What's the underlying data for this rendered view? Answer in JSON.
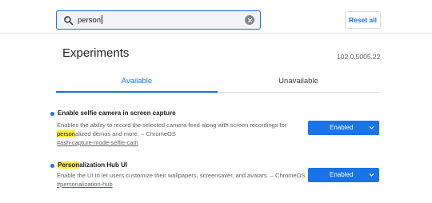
{
  "search": {
    "value": "person"
  },
  "header": {
    "reset_label": "Reset all"
  },
  "page": {
    "title": "Experiments",
    "version": "102.0.5005.22"
  },
  "tabs": [
    {
      "label": "Available",
      "selected": true
    },
    {
      "label": "Unavailable",
      "selected": false
    }
  ],
  "experiments": [
    {
      "name": "Enable selfie camera in screen capture",
      "desc_line1": "Enables the ability to record the selected camera feed along with screen recordings for",
      "desc_line2_highlight": "person",
      "desc_line2_rest": "alized demos and more. – ChromeOS",
      "link": "#ash-capture-mode-selfie-cam",
      "state": "Enabled"
    },
    {
      "name_highlight": "Person",
      "name_rest": "alization Hub UI",
      "desc_line1": "Enable the UI to let users customize their wallpapers, screensaver, and avatars. – ChromeOS",
      "link": "#personalization-hub",
      "state": "Enabled"
    }
  ],
  "colors": {
    "accent": "#1a73e8",
    "highlight": "#ffeb3b"
  },
  "icons": {
    "search": "search-icon",
    "clear": "clear-icon",
    "dropdown": "chevron-down-icon"
  }
}
